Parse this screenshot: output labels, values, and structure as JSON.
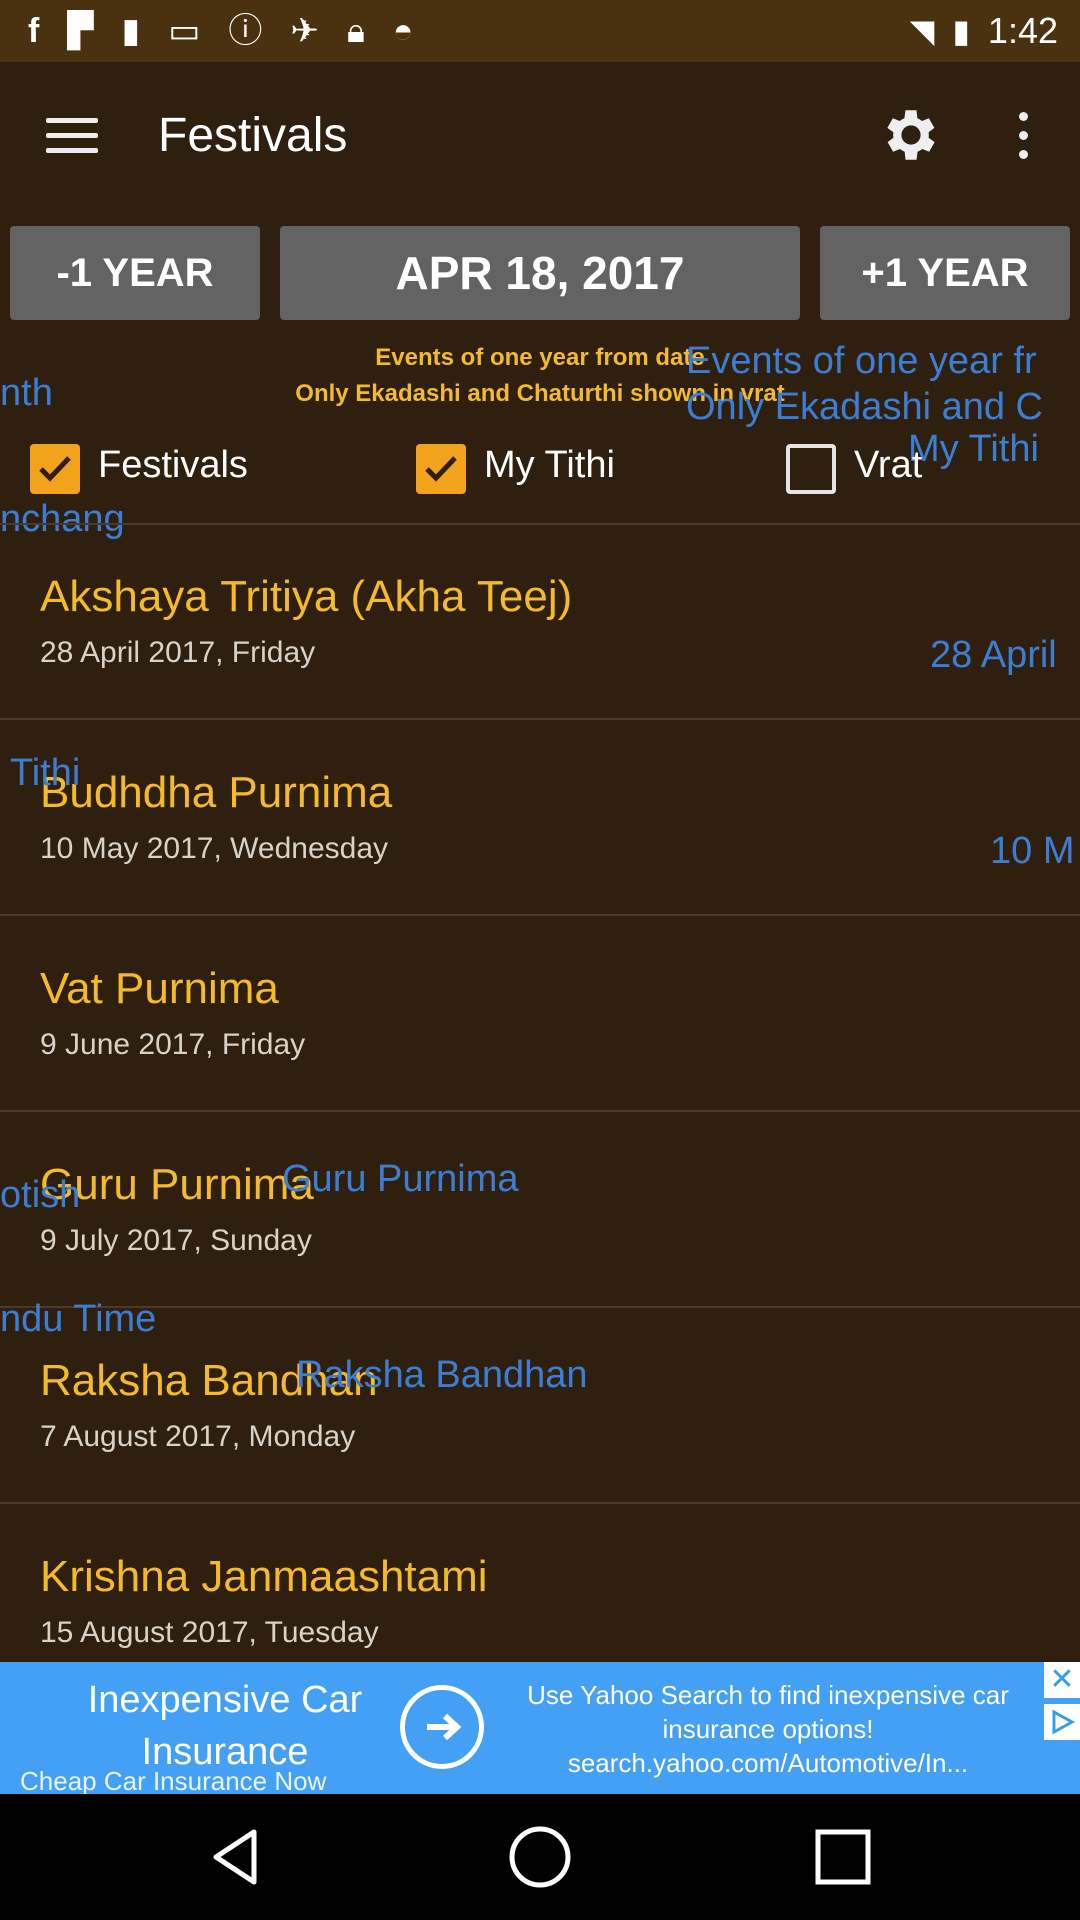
{
  "status_bar": {
    "time": "1:42",
    "icons": [
      "facebook-icon",
      "flipboard-icon",
      "notification-icon",
      "news-icon",
      "alert-icon",
      "gps-fake-icon",
      "lock-icon",
      "android-icon"
    ]
  },
  "app_bar": {
    "title": "Festivals",
    "icons": [
      "menu-icon",
      "gear-icon",
      "more-vert-icon"
    ]
  },
  "date_nav": {
    "prev_label": "-1 YEAR",
    "current_date": "APR 18, 2017",
    "next_label": "+1 YEAR"
  },
  "info": {
    "line1": "Events of one year from date",
    "line2": "Only Ekadashi and Chaturthi shown in vrat"
  },
  "filters": [
    {
      "label": "Festivals",
      "checked": true
    },
    {
      "label": "My Tithi",
      "checked": true
    },
    {
      "label": "Vrat",
      "checked": false
    }
  ],
  "ghost_texts": {
    "month": "nth",
    "panchang": "nchang",
    "events_echo1": "Events of one year fr",
    "events_echo2": "Only Ekadashi and C",
    "my_tithi": "My Tithi",
    "date_april": "28 April",
    "tithi": "Tithi",
    "date_may": "10 M",
    "jyotish": "otish",
    "guru": "Guru Purnima",
    "hindu_time": "ndu Time",
    "raksha": "Raksha Bandhan"
  },
  "events": [
    {
      "title": "Akshaya Tritiya (Akha Teej)",
      "date": "28 April 2017, Friday"
    },
    {
      "title": "Budhdha Purnima",
      "date": "10 May 2017, Wednesday"
    },
    {
      "title": "Vat Purnima",
      "date": "9 June 2017, Friday"
    },
    {
      "title": "Guru Purnima",
      "date": "9 July 2017, Sunday"
    },
    {
      "title": "Raksha Bandhan",
      "date": "7 August 2017, Monday"
    },
    {
      "title": "Krishna Janmaashtami",
      "date": "15 August 2017, Tuesday"
    }
  ],
  "ad": {
    "headline": "Inexpensive Car Insurance",
    "subline": "Cheap Car Insurance Now",
    "body": "Use Yahoo Search to find inexpensive car insurance options! search.yahoo.com/Automotive/In...",
    "close_symbol": "✕",
    "background": "#44a0f4"
  },
  "nav_bar": {
    "buttons": [
      "back-icon",
      "home-icon",
      "recents-icon"
    ]
  },
  "colors": {
    "background": "#2f1f0e",
    "accent": "#f4ba28",
    "ghost_blue": "#3c7ed4"
  }
}
